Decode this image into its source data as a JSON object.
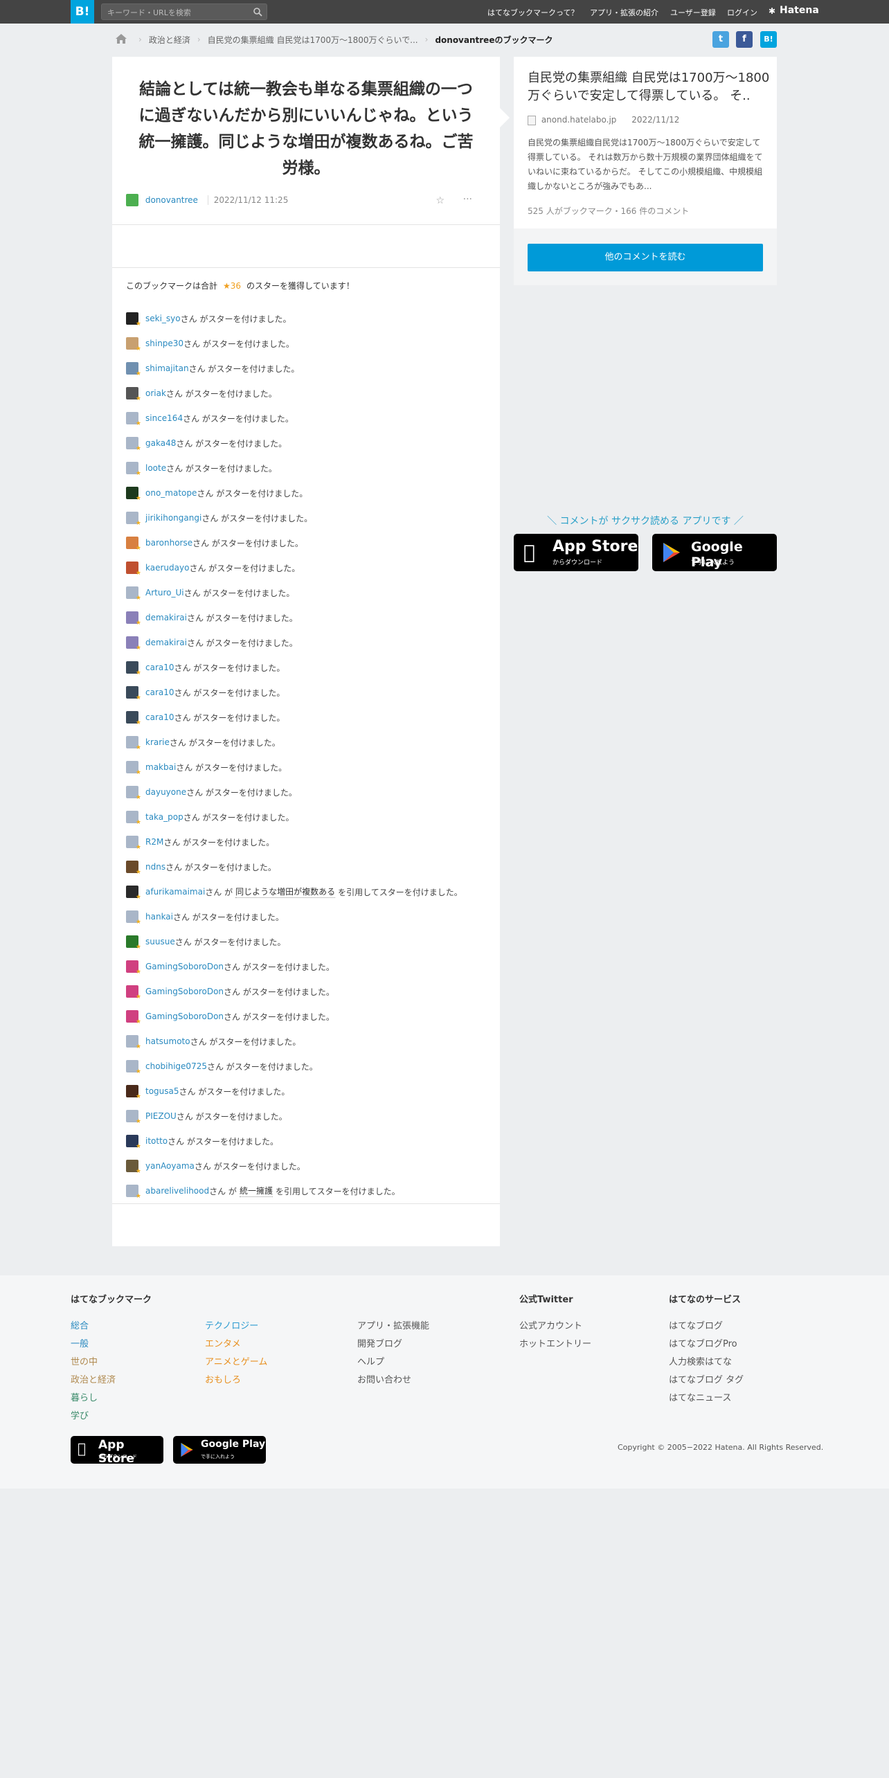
{
  "header": {
    "logo": "B!",
    "search_placeholder": "キーワード・URLを検索",
    "nav": [
      "はてなブックマークって？",
      "アプリ・拡張の紹介",
      "ユーザー登録",
      "ログイン"
    ],
    "brand": "Hatena"
  },
  "breadcrumb": [
    "政治と経済",
    "自民党の集票組織 自民党は1700万～1800万ぐらいで...",
    "donovantreeのブックマーク"
  ],
  "bookmark": {
    "comment": "結論としては統一教会も単なる集票組織の一つに過ぎないんだから別にいいんじゃね。という統一擁護。同じような増田が複数あるね。ご苦労様。",
    "user": "donovantree",
    "date": "2022/11/12 11:25"
  },
  "stars": {
    "summary_pre": "このブックマークは合計",
    "total": "★36",
    "summary_post": "のスターを獲得しています！",
    "suffix": "さん がスターを付けました。",
    "users": [
      {
        "name": "seki_syo",
        "color": "#222"
      },
      {
        "name": "shinpe30",
        "color": "#c8a070"
      },
      {
        "name": "shimajitan",
        "color": "#7090b0"
      },
      {
        "name": "oriak",
        "color": "#555"
      },
      {
        "name": "since164",
        "color": "#a9b6c8"
      },
      {
        "name": "gaka48",
        "color": "#a9b6c8"
      },
      {
        "name": "loote",
        "color": "#a9b6c8"
      },
      {
        "name": "ono_matope",
        "color": "#1d3a1d"
      },
      {
        "name": "jirikihongangi",
        "color": "#a9b6c8"
      },
      {
        "name": "baronhorse",
        "color": "#d88040"
      },
      {
        "name": "kaerudayo",
        "color": "#c05030"
      },
      {
        "name": "Arturo_Ui",
        "color": "#a9b6c8"
      },
      {
        "name": "demakirai",
        "color": "#8a80b8"
      },
      {
        "name": "demakirai",
        "color": "#8a80b8"
      },
      {
        "name": "cara10",
        "color": "#3a4a5a"
      },
      {
        "name": "cara10",
        "color": "#3a4a5a"
      },
      {
        "name": "cara10",
        "color": "#3a4a5a"
      },
      {
        "name": "krarie",
        "color": "#a9b6c8"
      },
      {
        "name": "makbai",
        "color": "#a9b6c8"
      },
      {
        "name": "dayuyone",
        "color": "#a9b6c8"
      },
      {
        "name": "taka_pop",
        "color": "#a9b6c8"
      },
      {
        "name": "R2M",
        "color": "#a9b6c8"
      },
      {
        "name": "ndns",
        "color": "#6a4a2a"
      },
      {
        "name": "afurikamaimai",
        "color": "#2a2a2a",
        "quote": "同じような増田が複数ある",
        "qpre": "さん が",
        "qpost": "を引用してスターを付けました。"
      },
      {
        "name": "hankai",
        "color": "#a9b6c8"
      },
      {
        "name": "suusue",
        "color": "#2a7a2a"
      },
      {
        "name": "GamingSoboroDon",
        "color": "#d04080"
      },
      {
        "name": "GamingSoboroDon",
        "color": "#d04080"
      },
      {
        "name": "GamingSoboroDon",
        "color": "#d04080"
      },
      {
        "name": "hatsumoto",
        "color": "#a9b6c8"
      },
      {
        "name": "chobihige0725",
        "color": "#a9b6c8"
      },
      {
        "name": "togusa5",
        "color": "#4a2a1a"
      },
      {
        "name": "PIEZOU",
        "color": "#a9b6c8"
      },
      {
        "name": "itotto",
        "color": "#2a3a5a"
      },
      {
        "name": "yanAoyama",
        "color": "#6a5a3a"
      },
      {
        "name": "abarelivelihood",
        "color": "#a9b6c8",
        "quote": "統一擁護",
        "qpre": "さん が",
        "qpost": "を引用してスターを付けました。"
      }
    ]
  },
  "entry": {
    "title": "自民党の集票組織 自民党は1700万～1800万ぐらいで安定して得票している。 そ..",
    "domain": "anond.hatelabo.jp",
    "date": "2022/11/12",
    "desc": "自民党の集票組織自民党は1700万～1800万ぐらいで安定して得票している。 それは数万から数十万規模の業界団体組織をていねいに束ねているからだ。 そしてこの小規模組織、中規模組織しかないところが強みでもあ...",
    "count": "525 人がブックマーク・166 件のコメント",
    "read_button": "他のコメントを読む"
  },
  "app_promo": {
    "message": "＼ コメントが サクサク読める アプリです ／",
    "appstore_big": "App Store",
    "appstore_small": "からダウンロード",
    "gplay_big": "Google Play",
    "gplay_small": "で手に入れよう"
  },
  "footer": {
    "heading1": "はてなブックマーク",
    "col1": [
      "総合",
      "一般",
      "世の中",
      "政治と経済",
      "暮らし",
      "学び"
    ],
    "col2": [
      "テクノロジー",
      "エンタメ",
      "アニメとゲーム",
      "おもしろ"
    ],
    "col3": [
      "アプリ・拡張機能",
      "開発ブログ",
      "ヘルプ",
      "お問い合わせ"
    ],
    "heading4": "公式Twitter",
    "col4": [
      "公式アカウント",
      "ホットエントリー"
    ],
    "heading5": "はてなのサービス",
    "col5": [
      "はてなブログ",
      "はてなブログPro",
      "人力検索はてな",
      "はてなブログ タグ",
      "はてなニュース"
    ],
    "copyright": "Copyright © 2005−2022 Hatena. All Rights Reserved."
  },
  "colors": {
    "accent": "#00a4de",
    "link": "#2a8ac0",
    "star": "#f0a020"
  }
}
